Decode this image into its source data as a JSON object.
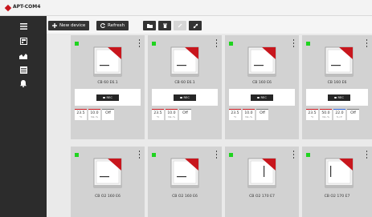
{
  "app": {
    "title": "APT-COM4"
  },
  "sidebar": {
    "items": [
      {
        "icon": "hamburger-menu-icon"
      },
      {
        "icon": "devices-grid-icon"
      },
      {
        "icon": "chart-icon"
      },
      {
        "icon": "list-icon"
      },
      {
        "icon": "bell-icon"
      }
    ]
  },
  "toolbar": {
    "new_device_label": "New device",
    "refresh_label": "Refresh",
    "icons": [
      "plus-icon",
      "refresh-icon",
      "folder-icon",
      "trash-icon",
      "link-icon",
      "expand-icon"
    ]
  },
  "colors": {
    "sidebar_bg": "#2c2c2c",
    "status_online": "#1fd41f",
    "brand_red": "#c8161d",
    "humidity_blue": "#2c63d6",
    "card_bg": "#d2d2d2"
  },
  "devices": [
    {
      "name": "CB 60 E6.1",
      "status": "online",
      "rec_label": "REC",
      "readings": [
        {
          "value": "23.5",
          "unit": "°C",
          "color": "red"
        },
        {
          "value": "10.0",
          "unit": "Vol.-%",
          "color": "red"
        },
        {
          "value": "Off",
          "unit": "",
          "color": "gray"
        }
      ]
    },
    {
      "name": "CB 60 E6.1",
      "status": "online",
      "rec_label": "REC",
      "readings": [
        {
          "value": "23.5",
          "unit": "°C",
          "color": "red"
        },
        {
          "value": "10.0",
          "unit": "Vol.-%",
          "color": "red"
        },
        {
          "value": "Off",
          "unit": "",
          "color": "gray"
        }
      ]
    },
    {
      "name": "CB 160 E6",
      "status": "online",
      "rec_label": "REC",
      "readings": [
        {
          "value": "23.5",
          "unit": "°C",
          "color": "red"
        },
        {
          "value": "10.0",
          "unit": "Vol.-%",
          "color": "red"
        },
        {
          "value": "Off",
          "unit": "",
          "color": "gray"
        }
      ]
    },
    {
      "name": "CB 160 E6",
      "status": "online",
      "rec_label": "REC",
      "readings": [
        {
          "value": "23.5",
          "unit": "°C",
          "color": "red"
        },
        {
          "value": "50.0",
          "unit": "Vol.-%",
          "color": "red"
        },
        {
          "value": "22.0",
          "unit": "% r.F.",
          "color": "blue"
        },
        {
          "value": "Off",
          "unit": "",
          "color": "gray"
        }
      ]
    },
    {
      "name": "CB O2 160 E6",
      "status": "online"
    },
    {
      "name": "CB O2 160 E6",
      "status": "online"
    },
    {
      "name": "CB O2 170 E7",
      "status": "online"
    },
    {
      "name": "CB O2 170 E7",
      "status": "online"
    }
  ]
}
